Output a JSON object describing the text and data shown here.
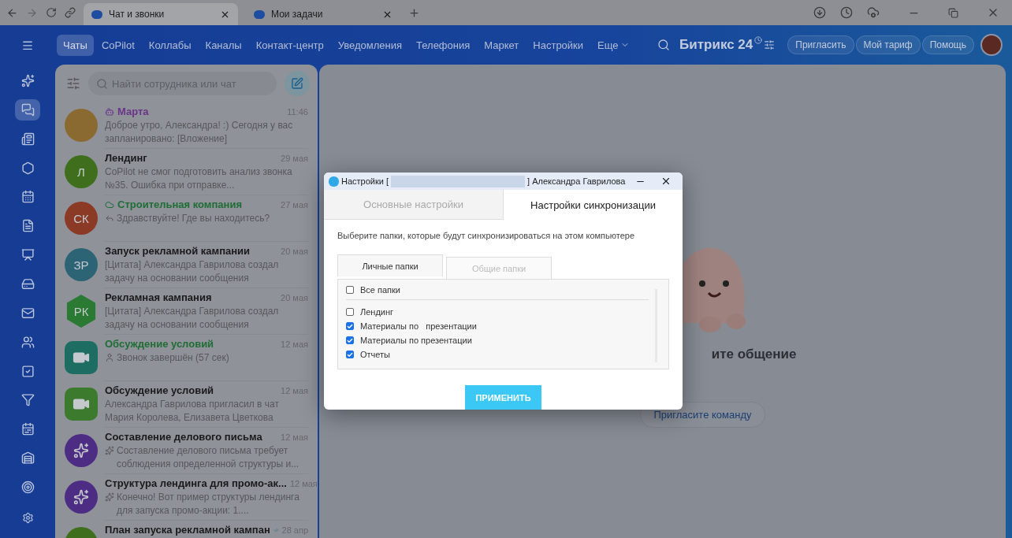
{
  "browser": {
    "tabs": [
      {
        "label": "Чат и звонки",
        "selected": true
      },
      {
        "label": "Мои задачи",
        "selected": false
      }
    ]
  },
  "nav": {
    "items": [
      {
        "label": "Чаты",
        "selected": true,
        "kind": "link"
      },
      {
        "label": "CoPilot",
        "selected": false,
        "kind": "link"
      },
      {
        "label": "Коллабы",
        "selected": false,
        "kind": "link"
      },
      {
        "label": "Каналы",
        "selected": false,
        "kind": "link"
      },
      {
        "label": "Контакт-центр",
        "selected": false,
        "kind": "link"
      },
      {
        "label": "Уведомления",
        "selected": false,
        "kind": "link"
      },
      {
        "label": "Телефония",
        "selected": false,
        "kind": "link"
      },
      {
        "label": "Маркет",
        "selected": false,
        "kind": "link"
      },
      {
        "label": "Настройки",
        "selected": false,
        "kind": "link"
      },
      {
        "label": "Еще",
        "selected": false,
        "kind": "more"
      }
    ],
    "logo": "Битрикс 24",
    "buttons": [
      "Пригласить",
      "Мой тариф",
      "Помощь"
    ]
  },
  "rail": {
    "items": [
      {
        "kind": "copilot",
        "selected": false
      },
      {
        "kind": "chat",
        "selected": true
      },
      {
        "kind": "feed",
        "selected": false
      },
      {
        "kind": "collab",
        "selected": false
      },
      {
        "kind": "calendar",
        "selected": false
      },
      {
        "kind": "docs",
        "selected": false
      },
      {
        "kind": "board",
        "selected": false
      },
      {
        "kind": "disk",
        "selected": false
      },
      {
        "kind": "mail",
        "selected": false
      },
      {
        "kind": "team",
        "selected": false
      },
      {
        "kind": "tasks",
        "selected": false
      },
      {
        "kind": "funnel",
        "selected": false
      },
      {
        "kind": "schedule",
        "selected": false
      },
      {
        "kind": "store",
        "selected": false
      },
      {
        "kind": "target",
        "selected": false
      }
    ]
  },
  "search": {
    "placeholder": "Найти сотрудника или чат"
  },
  "chats": [
    {
      "kind": "bot",
      "title": "Марта",
      "date": "11:46",
      "preview": "Доброе утро, Александра! :) Сегодня у вас запланировано: [Вложение]",
      "avatar": {
        "kind": "cartoon"
      },
      "color": "#6a3589"
    },
    {
      "kind": "chat",
      "title": "Лендинг",
      "date": "29 мая",
      "preview": "CoPilot не смог подготовить анализ звонка №35. Ошибка при отправке...",
      "avatar": {
        "kind": "initials",
        "text": "Л",
        "color": "#3f6f1c"
      }
    },
    {
      "kind": "client",
      "title": "Строительная компания",
      "date": "27 мая",
      "preview": "Здравствуйте! Где вы находитесь?",
      "avatar": {
        "kind": "initials",
        "text": "СК",
        "color": "#8b3a25"
      },
      "color": "#1f6e36"
    },
    {
      "kind": "chat",
      "title": "Запуск рекламной кампании",
      "date": "20 мая",
      "preview": "[Цитата] Александра Гаврилова создал задачу на основании сообщения",
      "avatar": {
        "kind": "initials",
        "text": "ЗР",
        "color": "#2c6476"
      }
    },
    {
      "kind": "chat",
      "title": "Рекламная кампания",
      "date": "20 мая",
      "preview": "[Цитата] Александра Гаврилова создал задачу на основании сообщения",
      "avatar": {
        "kind": "hexagon",
        "text": "РК",
        "color": "#2a7a33"
      }
    },
    {
      "kind": "call",
      "title": "Обсуждение условий",
      "date": "12 мая",
      "preview": "Звонок завершён (57 сек)",
      "avatar": {
        "kind": "video",
        "color": "#1d6d63"
      },
      "color": "#1f6e36"
    },
    {
      "kind": "chat",
      "title": "Обсуждение условий",
      "date": "12 мая",
      "preview": "Александра Гаврилова пригласил в чат Мария Королева, Елизавета Цветкова",
      "avatar": {
        "kind": "video",
        "color": "#3c7a2d"
      }
    },
    {
      "kind": "copilot",
      "title": "Составление делового письма",
      "date": "12 мая",
      "preview": "Составление делового письма требует соблюдения определенной структуры и...",
      "avatar": {
        "kind": "copilot",
        "color": "#4d2d84"
      }
    },
    {
      "kind": "copilot",
      "title": "Структура лендинга для промо-ак...",
      "date": "12 мая",
      "preview": "Конечно! Вот пример структуры лендинга для запуска промо-акции: 1....",
      "avatar": {
        "kind": "copilot",
        "color": "#4d2d84"
      }
    },
    {
      "kind": "chat",
      "title": "План запуска рекламной кампан",
      "date": "28 апр",
      "avatar": {
        "kind": "initials",
        "color": "#3f6f1c"
      },
      "read": true
    }
  ],
  "empty_state": {
    "heading": "ите общение",
    "button": "Пригласите команду"
  },
  "dialog": {
    "title_start": "Настройки [",
    "title_end": "] Александра Гаврилова",
    "tabs": [
      {
        "label": "Основные настройки",
        "selected": false
      },
      {
        "label": "Настройки синхронизации",
        "selected": true
      }
    ],
    "instruction": "Выберите папки, которые будут синхронизироваться на этом компьютере",
    "folder_tabs": [
      {
        "label": "Личные папки",
        "selected": true
      },
      {
        "label": "Общие папки",
        "selected": false
      }
    ],
    "all_folders": {
      "label": "Все папки",
      "checked": false
    },
    "folders": [
      {
        "label": "Лендинг",
        "checked": false
      },
      {
        "label": "Материалы по   презентации",
        "checked": true
      },
      {
        "label": "Материалы по презентации",
        "checked": true
      },
      {
        "label": "Отчеты",
        "checked": true
      }
    ],
    "apply": "ПРИМЕНИТЬ"
  }
}
